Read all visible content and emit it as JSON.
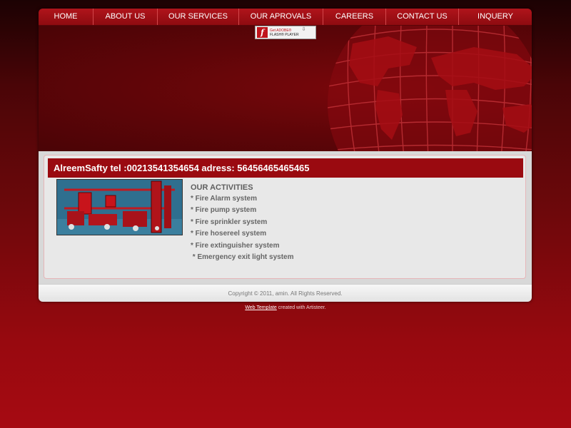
{
  "nav": {
    "items": [
      {
        "label": "HOME"
      },
      {
        "label": "ABOUT US"
      },
      {
        "label": "OUR SERVICES"
      },
      {
        "label": "OUR APROVALS"
      },
      {
        "label": "CAREERS"
      },
      {
        "label": "CONTACT US"
      },
      {
        "label": "INQUERY"
      }
    ]
  },
  "flash": {
    "get": "Get ADOBE®",
    "player": "FLASH® PLAYER",
    "logo": "f",
    "icon": "flash-player-icon"
  },
  "content": {
    "title": "AlreemSafty tel :00213541354654 adress: 56456465465465",
    "activities_heading": "OUR ACTIVITIES",
    "activities": [
      "* Fire Alarm system",
      "* Fire pump system",
      "* Fire sprinkler system",
      "* Fire hosereel system",
      "* Fire extinguisher system",
      " * Emergency exit light system"
    ]
  },
  "footer": {
    "copyright": "Copyright © 2011, amin. All Rights Reserved."
  },
  "credit": {
    "link": "Web Template",
    "suffix": " created with Artisteer."
  },
  "colors": {
    "nav_bg": "#a3111a",
    "title_bar": "#9a0a10",
    "page_bg": "#a60a12"
  }
}
